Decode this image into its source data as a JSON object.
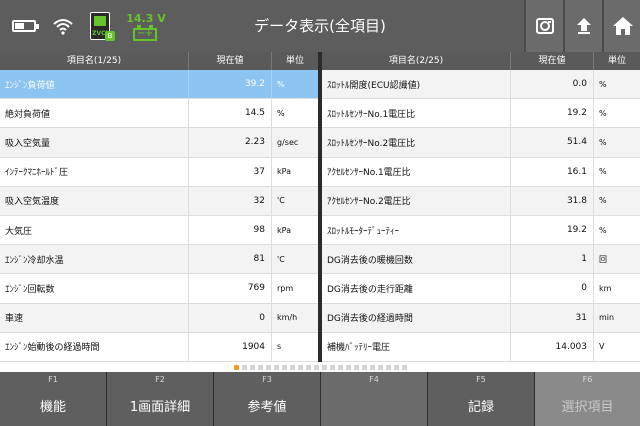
{
  "header": {
    "title": "データ表示(全項目)",
    "voltage": "14.3 V",
    "battery_level": 0.5,
    "zvci_label": "ZVCI",
    "zvci_badge": "B",
    "car_battery_minus": "−",
    "car_battery_plus": "+",
    "icons": [
      "battery-icon",
      "wifi-icon",
      "zvci-icon",
      "car-battery-icon",
      "camera-icon",
      "upload-icon",
      "home-icon"
    ],
    "accent_green": "#67c32a"
  },
  "left_table": {
    "col_name": "項目名(1/25)",
    "col_value": "現在値",
    "col_unit": "単位",
    "rows": [
      {
        "name": "ｴﾝｼﾞﾝ負荷値",
        "value": "39.2",
        "unit": "%"
      },
      {
        "name": "絶対負荷値",
        "value": "14.5",
        "unit": "%"
      },
      {
        "name": "吸入空気量",
        "value": "2.23",
        "unit": "g/sec"
      },
      {
        "name": "ｲﾝﾃｰｸﾏﾆﾎｰﾙﾄﾞ圧",
        "value": "37",
        "unit": "kPa"
      },
      {
        "name": "吸入空気温度",
        "value": "32",
        "unit": "'C"
      },
      {
        "name": "大気圧",
        "value": "98",
        "unit": "kPa"
      },
      {
        "name": "ｴﾝｼﾞﾝ冷却水温",
        "value": "81",
        "unit": "'C"
      },
      {
        "name": "ｴﾝｼﾞﾝ回転数",
        "value": "769",
        "unit": "rpm"
      },
      {
        "name": "車速",
        "value": "0",
        "unit": "km/h"
      },
      {
        "name": "ｴﾝｼﾞﾝ始動後の経過時間",
        "value": "1904",
        "unit": "s"
      }
    ]
  },
  "right_table": {
    "col_name": "項目名(2/25)",
    "col_value": "現在値",
    "col_unit": "単位",
    "rows": [
      {
        "name": "ｽﾛｯﾄﾙ開度(ECU認識値)",
        "value": "0.0",
        "unit": "%"
      },
      {
        "name": "ｽﾛｯﾄﾙｾﾝｻｰNo.1電圧比",
        "value": "19.2",
        "unit": "%"
      },
      {
        "name": "ｽﾛｯﾄﾙｾﾝｻｰNo.2電圧比",
        "value": "51.4",
        "unit": "%"
      },
      {
        "name": "ｱｸｾﾙｾﾝｻｰNo.1電圧比",
        "value": "16.1",
        "unit": "%"
      },
      {
        "name": "ｱｸｾﾙｾﾝｻｰNo.2電圧比",
        "value": "31.8",
        "unit": "%"
      },
      {
        "name": "ｽﾛｯﾄﾙﾓｰﾀｰﾃﾞｭｰﾃｨｰ",
        "value": "19.2",
        "unit": "%"
      },
      {
        "name": "DG消去後の暖機回数",
        "value": "1",
        "unit": "回"
      },
      {
        "name": "DG消去後の走行距離",
        "value": "0",
        "unit": "km"
      },
      {
        "name": "DG消去後の経過時間",
        "value": "31",
        "unit": "min"
      },
      {
        "name": "補機ﾊﾞｯﾃﾘｰ電圧",
        "value": "14.003",
        "unit": "V"
      }
    ]
  },
  "pager": {
    "total": 22,
    "active": 0,
    "active_color": "#f39c25"
  },
  "function_keys": [
    {
      "key": "F1",
      "label": "機能"
    },
    {
      "key": "F2",
      "label": "1画面詳細"
    },
    {
      "key": "F3",
      "label": "参考値"
    },
    {
      "key": "F4",
      "label": ""
    },
    {
      "key": "F5",
      "label": "記録"
    },
    {
      "key": "F6",
      "label": "選択項目"
    }
  ]
}
